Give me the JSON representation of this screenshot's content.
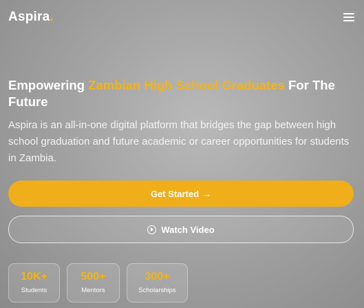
{
  "brand": {
    "name": "Aspira",
    "dot": ".",
    "accent_color": "#f2b41a"
  },
  "nav": {
    "menu_icon": "hamburger-menu-icon"
  },
  "hero": {
    "title_pre": "Empowering ",
    "title_highlight": "Zambian High School Graduates",
    "title_post": " For The Future",
    "description": "Aspira is an all-in-one digital platform that bridges the gap between high school graduation and future academic or career opportunities for students in Zambia."
  },
  "buttons": {
    "primary_label": "Get Started",
    "primary_icon": "→",
    "secondary_label": "Watch Video",
    "secondary_icon": "play-circle-icon"
  },
  "stats": [
    {
      "value": "10K+",
      "label": "Students"
    },
    {
      "value": "500+",
      "label": "Mentors"
    },
    {
      "value": "300+",
      "label": "Scholarships"
    }
  ]
}
